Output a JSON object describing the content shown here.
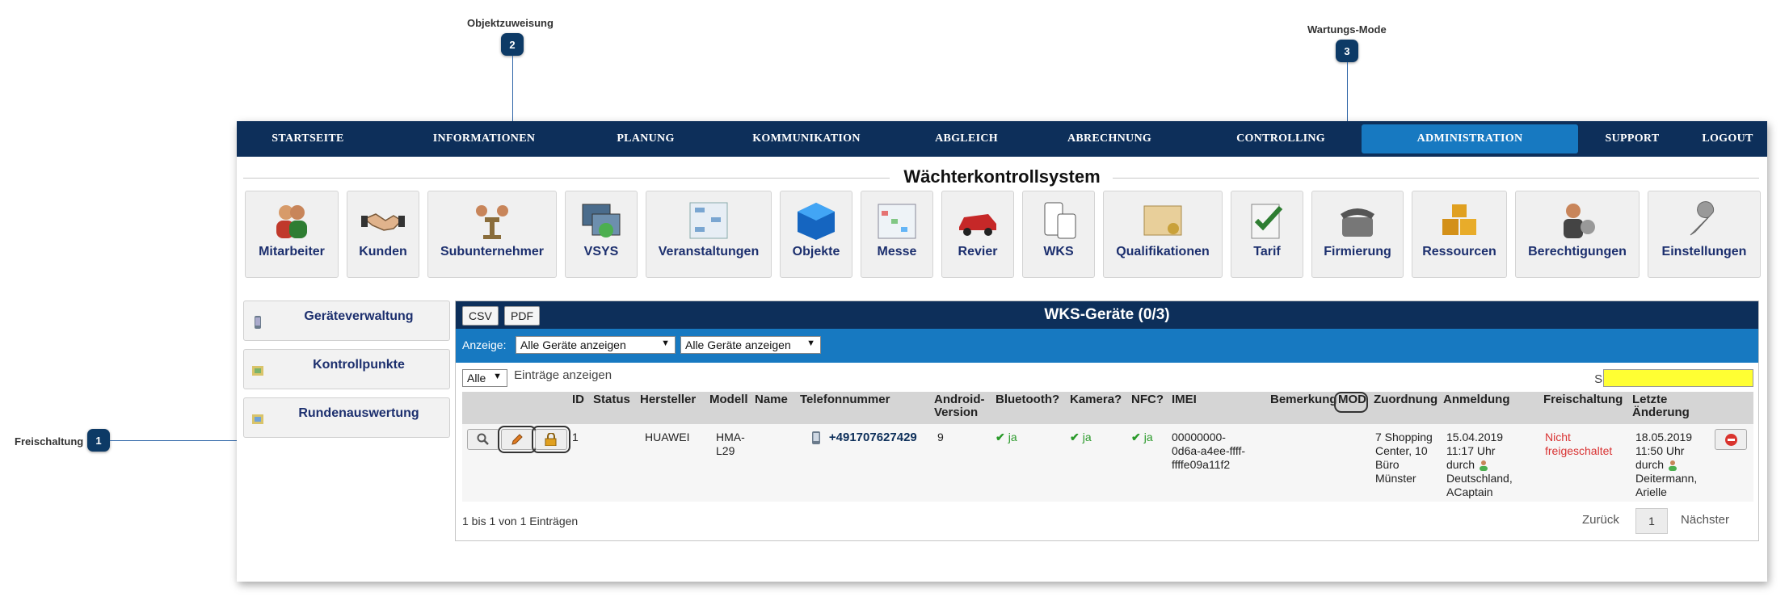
{
  "callouts": [
    {
      "number": "1",
      "label": "Freischaltung"
    },
    {
      "number": "2",
      "label": "Objektzuweisung"
    },
    {
      "number": "3",
      "label": "Wartungs-Mode"
    }
  ],
  "nav": {
    "items": [
      "STARTSEITE",
      "INFORMATIONEN",
      "PLANUNG",
      "KOMMUNIKATION",
      "ABGLEICH",
      "ABRECHNUNG",
      "CONTROLLING",
      "ADMINISTRATION",
      "SUPPORT",
      "LOGOUT"
    ],
    "active": "ADMINISTRATION"
  },
  "system_title": "Wächterkontrollsystem",
  "modules": [
    "Mitarbeiter",
    "Kunden",
    "Subunternehmer",
    "VSYS",
    "Veranstaltungen",
    "Objekte",
    "Messe",
    "Revier",
    "WKS",
    "Qualifikationen",
    "Tarif",
    "Firmierung",
    "Ressourcen",
    "Berechtigungen",
    "Einstellungen"
  ],
  "sidebar": {
    "items": [
      "Geräteverwaltung",
      "Kontrollpunkte",
      "Rundenauswertung"
    ]
  },
  "panel": {
    "title": "WKS-Geräte (0/3)",
    "export_buttons": [
      "CSV",
      "PDF"
    ],
    "filter_label": "Anzeige:",
    "filter1_value": "Alle Geräte anzeigen",
    "filter2_value": "Alle Geräte anzeigen",
    "length_value": "Alle",
    "length_suffix": "Einträge anzeigen",
    "search_label": "Suchen",
    "columns": [
      "ID",
      "Status",
      "Hersteller",
      "Modell",
      "Name",
      "Telefonnummer",
      "Android-Version",
      "Bluetooth?",
      "Kamera?",
      "NFC?",
      "IMEI",
      "Bemerkung",
      "MOD",
      "Zuordnung",
      "Anmeldung",
      "Freischaltung",
      "Letzte Änderung"
    ],
    "row": {
      "id": "1",
      "status": "",
      "hersteller": "HUAWEI",
      "modell": "HMA-L29",
      "name": "",
      "telefon": "+491707627429",
      "android": "9",
      "bluetooth": "ja",
      "kamera": "ja",
      "nfc": "ja",
      "imei": "00000000-0d6a-a4ee-ffff-ffffe09a11f2",
      "bemerkung": "",
      "mod": "",
      "zuordnung": "7 Shopping Center, 10 Büro Münster",
      "anmeldung_date": "15.04.2019",
      "anmeldung_time": "11:17 Uhr",
      "anmeldung_by": "durch",
      "anmeldung_user": "Deutschland, ACaptain",
      "freischaltung": "Nicht freigeschaltet",
      "aenderung_date": "18.05.2019",
      "aenderung_time": "11:50 Uhr",
      "aenderung_by": "durch",
      "aenderung_user": "Deitermann, Arielle"
    },
    "info": "1 bis 1 von 1 Einträgen",
    "pager": {
      "prev": "Zurück",
      "current": "1",
      "next": "Nächster"
    }
  }
}
